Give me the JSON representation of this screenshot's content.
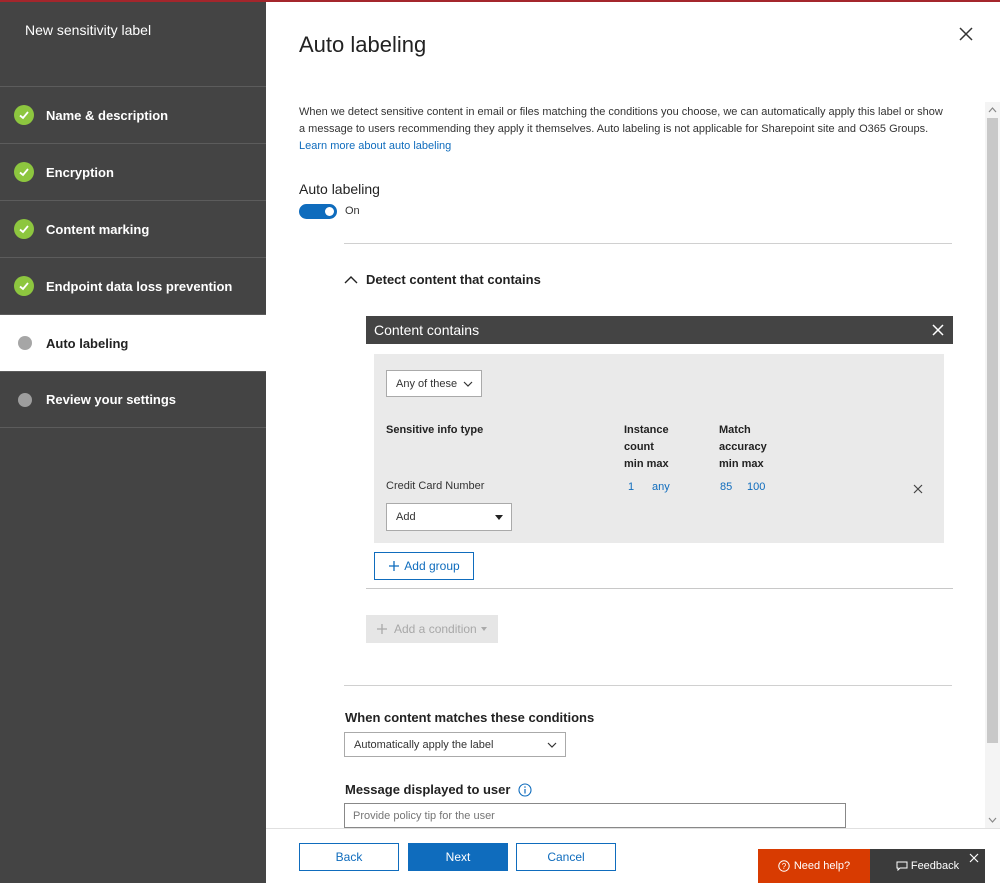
{
  "sidebar": {
    "title": "New sensitivity label",
    "steps": [
      {
        "label": "Name & description",
        "state": "complete"
      },
      {
        "label": "Encryption",
        "state": "complete"
      },
      {
        "label": "Content marking",
        "state": "complete"
      },
      {
        "label": "Endpoint data loss prevention",
        "state": "complete"
      },
      {
        "label": "Auto labeling",
        "state": "current"
      },
      {
        "label": "Review your settings",
        "state": "pending"
      }
    ]
  },
  "main": {
    "title": "Auto labeling",
    "intro_text": "When we detect sensitive content in email or files matching the conditions you choose, we can automatically apply this label or show a message to users recommending they apply it themselves. Auto labeling is not applicable for Sharepoint site and O365 Groups.",
    "intro_link": "Learn more about auto labeling",
    "auto_labeling_heading": "Auto labeling",
    "toggle_state": "On",
    "section_heading": "Detect content that contains",
    "condition_panel": {
      "title": "Content contains",
      "match_mode": "Any of these",
      "columns": {
        "info_type": "Sensitive info type",
        "instance_line1": "Instance",
        "instance_line2": "count",
        "instance_line3": "min max",
        "accuracy_line1": "Match",
        "accuracy_line2": "accuracy",
        "accuracy_line3": "min max"
      },
      "rows": [
        {
          "type": "Credit Card Number",
          "count_min": "1",
          "count_max": "any",
          "acc_min": "85",
          "acc_max": "100"
        }
      ],
      "add_dropdown": "Add"
    },
    "add_group_label": "Add group",
    "add_condition_label": "Add a condition",
    "when_matches_heading": "When content matches these conditions",
    "apply_action": "Automatically apply the label",
    "message_heading": "Message displayed to user",
    "message_placeholder": "Provide policy tip for the user"
  },
  "footer": {
    "back": "Back",
    "next": "Next",
    "cancel": "Cancel",
    "help": "Need help?",
    "feedback": "Feedback"
  },
  "colors": {
    "accent": "#0f6cbd",
    "sidebar_bg": "#444444",
    "complete_check": "#8dc63f",
    "help_bg": "#d83b01"
  }
}
